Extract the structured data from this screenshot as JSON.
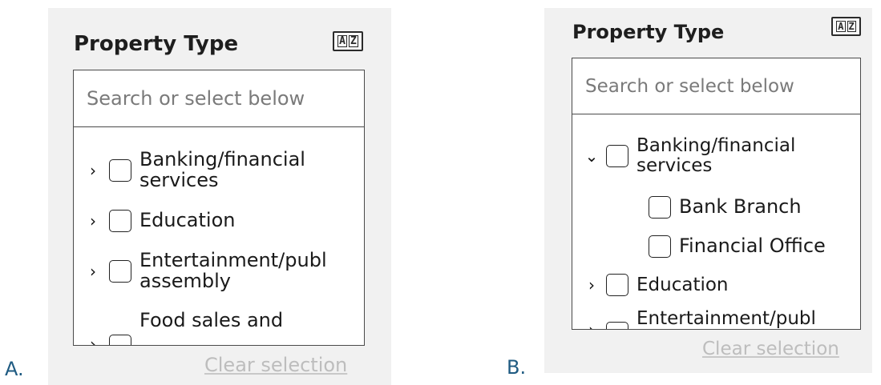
{
  "figure_labels": {
    "a": "A.",
    "b": "B."
  },
  "panel_a": {
    "title": "Property Type",
    "sort_icon": "az-sort-icon",
    "sort_icon_text": [
      "A",
      "Z"
    ],
    "search_placeholder": "Search or select below",
    "items": [
      {
        "label_line1": "Banking/financial",
        "label_line2": "services",
        "expanded": false
      },
      {
        "label_line1": "Education",
        "label_line2": "",
        "expanded": false
      },
      {
        "label_line1": "Entertainment/publ",
        "label_line2": "assembly",
        "expanded": false
      },
      {
        "label_line1": "Food sales and",
        "label_line2": "",
        "expanded": false
      }
    ],
    "clear_label": "Clear selection"
  },
  "panel_b": {
    "title": "Property Type",
    "sort_icon": "az-sort-icon",
    "sort_icon_text": [
      "A",
      "Z"
    ],
    "search_placeholder": "Search or select below",
    "items": [
      {
        "label_line1": "Banking/financial",
        "label_line2": "services",
        "expanded": true,
        "children": [
          {
            "label": "Bank Branch"
          },
          {
            "label": "Financial Office"
          }
        ]
      },
      {
        "label_line1": "Education",
        "label_line2": "",
        "expanded": false
      },
      {
        "label_line1": "Entertainment/publ",
        "label_line2": "",
        "expanded": false
      }
    ],
    "clear_label": "Clear selection"
  },
  "colors": {
    "panel_bg": "#f1f1f1",
    "border": "#4a4a4a",
    "placeholder": "#7a7a7a",
    "disabled_link": "#bdbdbd",
    "figure_label": "#1f5b82"
  }
}
